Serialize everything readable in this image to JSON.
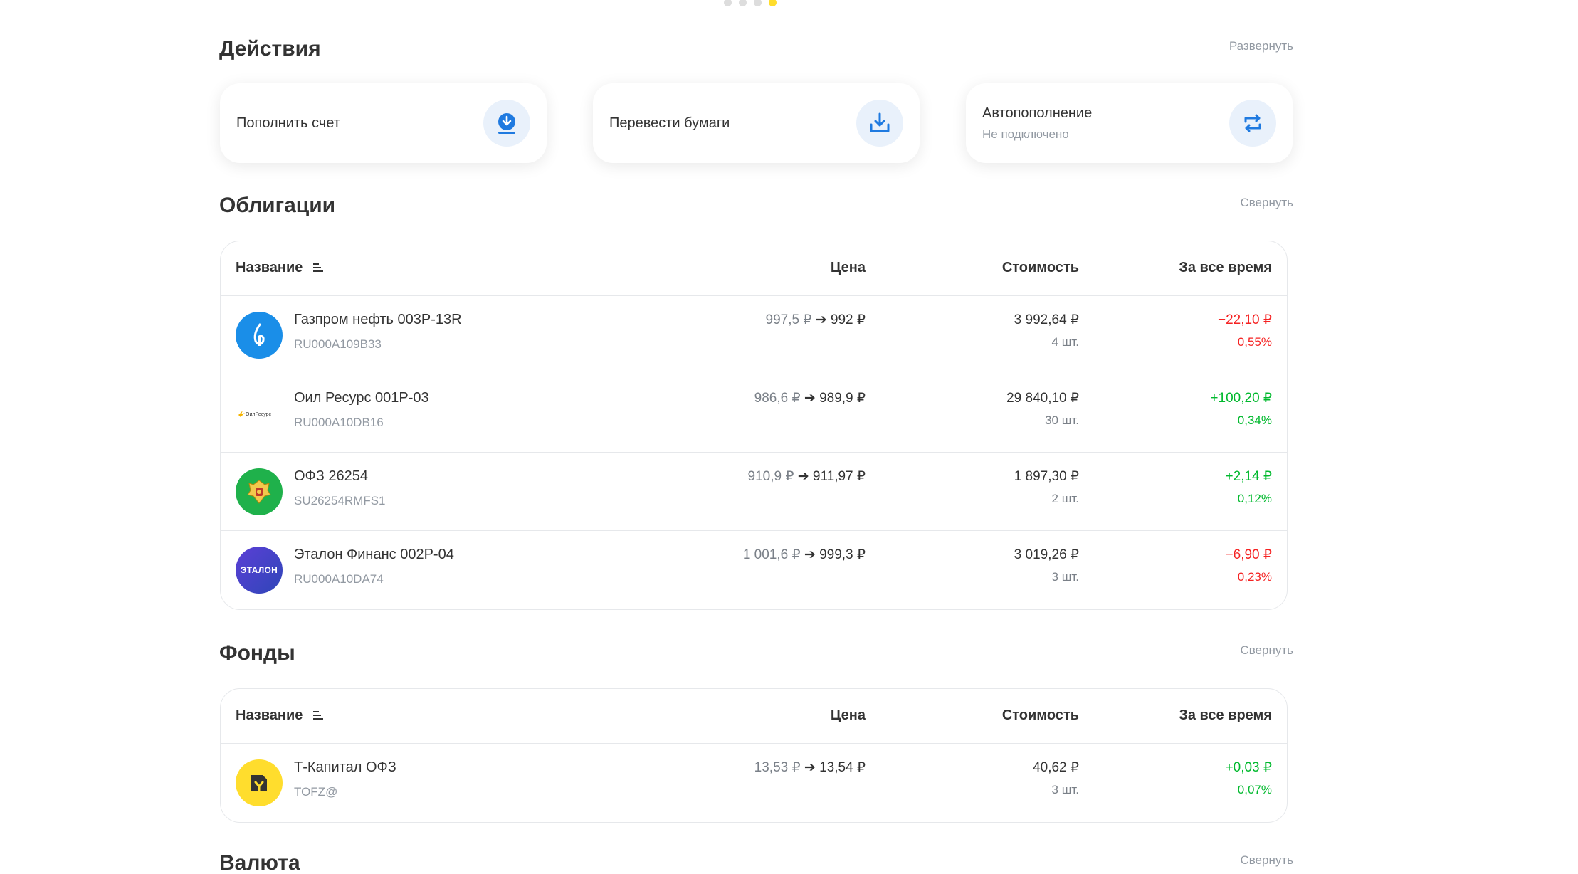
{
  "carousel": {
    "dots": 4,
    "active": 4
  },
  "actions": {
    "title": "Действия",
    "expand_label": "Развернуть",
    "cards": [
      {
        "label": "Пополнить счет",
        "sub": "",
        "icon": "download-circle-icon"
      },
      {
        "label": "Перевести бумаги",
        "sub": "",
        "icon": "download-tray-icon"
      },
      {
        "label": "Автопополнение",
        "sub": "Не подключено",
        "icon": "repeat-icon"
      }
    ]
  },
  "bonds": {
    "title": "Облигации",
    "collapse_label": "Свернуть",
    "columns": {
      "name": "Название",
      "price": "Цена",
      "value": "Стоимость",
      "alltime": "За все время"
    },
    "rows": [
      {
        "name": "Газпром нефть 003Р-13R",
        "isin": "RU000A109B33",
        "price_old": "997,5 ₽",
        "price_new": "992 ₽",
        "value": "3 992,64 ₽",
        "qty": "4 шт.",
        "pnl": "−22,10 ₽",
        "pct": "0,55%",
        "trend": "neg",
        "logo": "gazprom-neft-logo",
        "logo_color": "#1a8ee8"
      },
      {
        "name": "Оил Ресурс 001Р-03",
        "isin": "RU000A10DB16",
        "price_old": "986,6 ₽",
        "price_new": "989,9 ₽",
        "value": "29 840,10 ₽",
        "qty": "30 шт.",
        "pnl": "+100,20 ₽",
        "pct": "0,34%",
        "trend": "pos",
        "logo": "oil-resurs-logo",
        "logo_text": "ОилРесурс",
        "logo_color": "#ffffff"
      },
      {
        "name": "ОФЗ 26254",
        "isin": "SU26254RMFS1",
        "price_old": "910,9 ₽",
        "price_new": "911,97 ₽",
        "value": "1 897,30 ₽",
        "qty": "2 шт.",
        "pnl": "+2,14 ₽",
        "pct": "0,12%",
        "trend": "pos",
        "logo": "minfin-emblem-logo",
        "logo_color": "#1fb14b"
      },
      {
        "name": "Эталон Финанс 002Р-04",
        "isin": "RU000A10DA74",
        "price_old": "1 001,6 ₽",
        "price_new": "999,3 ₽",
        "value": "3 019,26 ₽",
        "qty": "3 шт.",
        "pnl": "−6,90 ₽",
        "pct": "0,23%",
        "trend": "neg",
        "logo": "etalon-logo",
        "logo_text": "ЭТАЛОН",
        "logo_color": "#4a3fc9"
      }
    ]
  },
  "funds": {
    "title": "Фонды",
    "collapse_label": "Свернуть",
    "columns": {
      "name": "Название",
      "price": "Цена",
      "value": "Стоимость",
      "alltime": "За все время"
    },
    "rows": [
      {
        "name": "Т-Капитал ОФЗ",
        "isin": "TOFZ@",
        "price_old": "13,53 ₽",
        "price_new": "13,54 ₽",
        "value": "40,62 ₽",
        "qty": "3 шт.",
        "pnl": "+0,03 ₽",
        "pct": "0,07%",
        "trend": "pos",
        "logo": "t-capital-logo",
        "logo_color": "#ffdd2d"
      }
    ]
  },
  "currency": {
    "title": "Валюта",
    "collapse_label": "Свернуть"
  },
  "colors": {
    "accent": "#ffdd2d",
    "negative": "#f52222",
    "positive": "#00b92d",
    "icon": "#1f7ae0"
  }
}
